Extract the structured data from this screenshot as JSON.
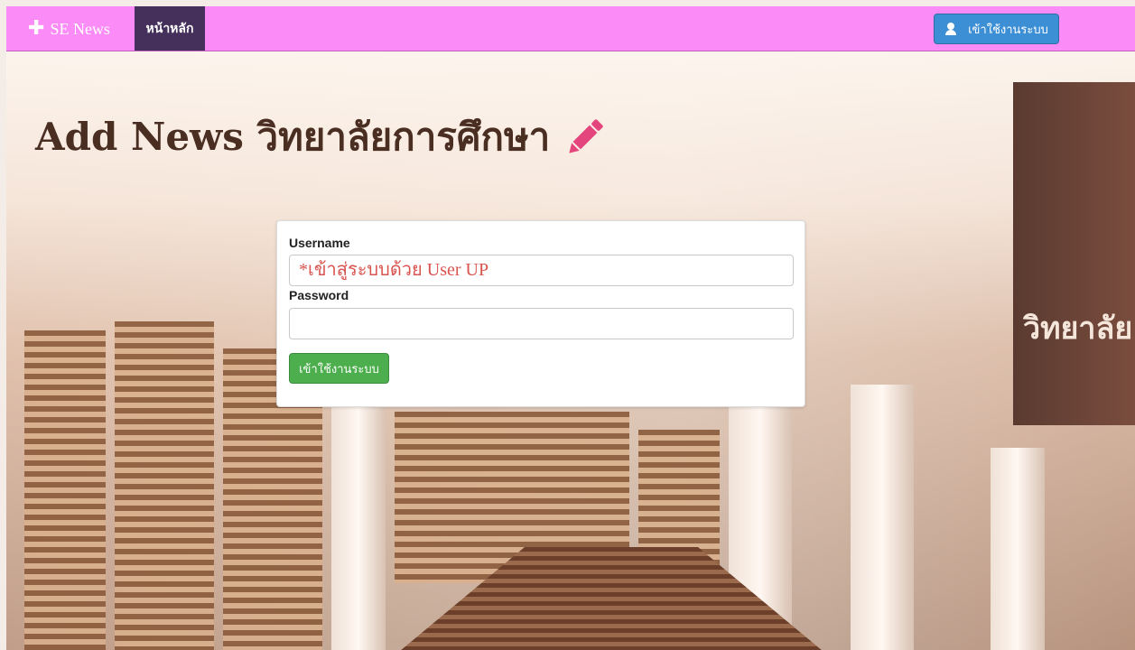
{
  "navbar": {
    "brand_label": "SE News",
    "home_label": "หน้าหลัก",
    "login_label": "เข้าใช้งานระบบ",
    "bg_color": "#fb8bf6",
    "active_tab_color": "#44305a"
  },
  "header": {
    "title": "Add News วิทยาลัยการศึกษา"
  },
  "login_form": {
    "username_label": "Username",
    "username_placeholder": "*เข้าสู่ระบบด้วย User UP",
    "username_value": "",
    "password_label": "Password",
    "password_value": "",
    "submit_label": "เข้าใช้งานระบบ"
  },
  "background": {
    "sign_text": "วิทยาลัย"
  },
  "colors": {
    "accent": "#e5457d",
    "login_button": "#3c8fd4",
    "submit_button": "#4cae4c",
    "placeholder_red": "#d9534f"
  },
  "icons": [
    "plus-icon",
    "user-icon",
    "pencil-icon"
  ]
}
